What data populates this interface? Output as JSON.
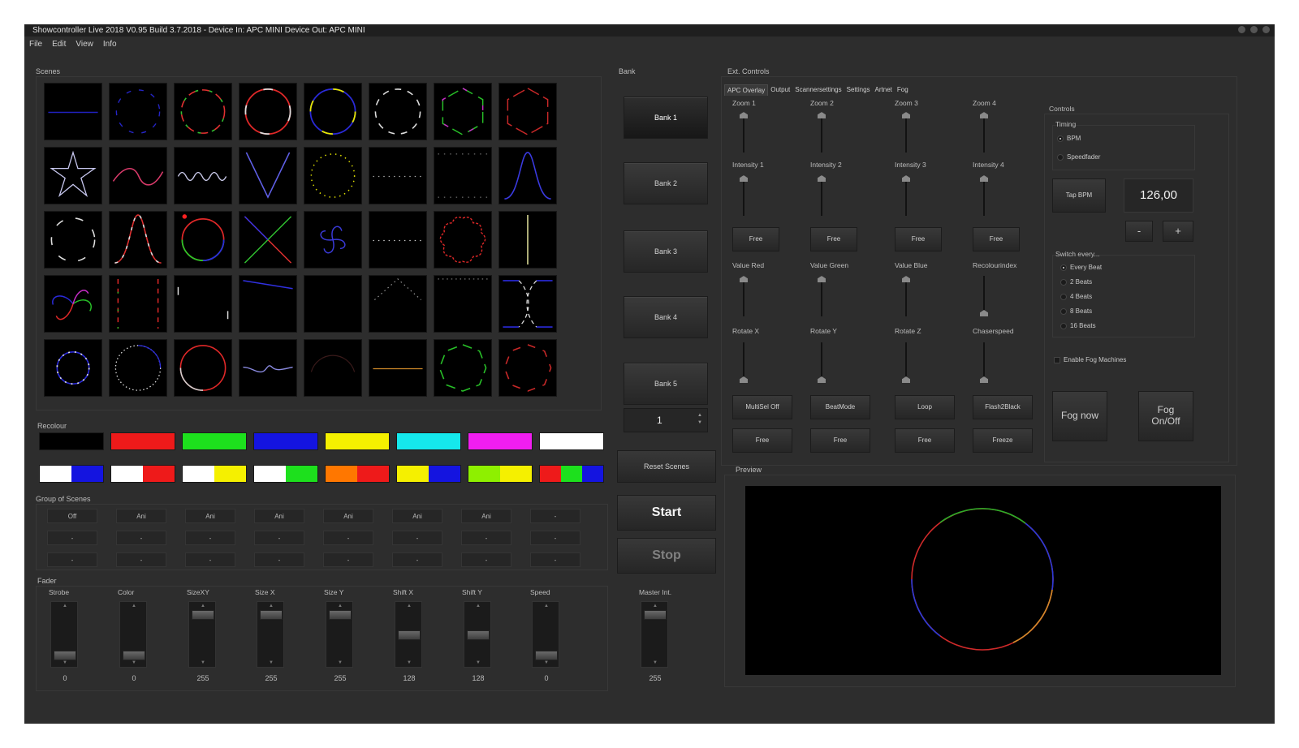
{
  "window": {
    "title": "Showcontroller Live 2018 V0.95 Build 3.7.2018 - Device In: APC MINI  Device Out: APC MINI"
  },
  "menu": [
    "File",
    "Edit",
    "View",
    "Info"
  ],
  "scenes": {
    "title": "Scenes"
  },
  "recolour": {
    "title": "Recolour",
    "row1": [
      [
        "#000000"
      ],
      [
        "#ee1a1a"
      ],
      [
        "#1de01d"
      ],
      [
        "#1414e0"
      ],
      [
        "#f5f000"
      ],
      [
        "#15e8ec"
      ],
      [
        "#f01ef0"
      ],
      [
        "#ffffff"
      ]
    ],
    "row2": [
      [
        "#ffffff",
        "#1414e0"
      ],
      [
        "#ffffff",
        "#ee1a1a"
      ],
      [
        "#ffffff",
        "#f5f000"
      ],
      [
        "#ffffff",
        "#1de01d"
      ],
      [
        "#ff7700",
        "#ee1a1a"
      ],
      [
        "#f5f000",
        "#1414e0"
      ],
      [
        "#8ef000",
        "#f5f000"
      ],
      [
        "#ee1a1a",
        "#1de01d",
        "#1414e0"
      ]
    ]
  },
  "group_of_scenes": {
    "title": "Group of Scenes",
    "rows": [
      [
        "Off",
        "Ani",
        "Ani",
        "Ani",
        "Ani",
        "Ani",
        "Ani",
        "-"
      ],
      [
        "-",
        "-",
        "-",
        "-",
        "-",
        "-",
        "-",
        "-"
      ],
      [
        "-",
        "-",
        "-",
        "-",
        "-",
        "-",
        "-",
        "-"
      ]
    ]
  },
  "fader": {
    "title": "Fader",
    "items": [
      {
        "label": "Strobe",
        "value": "0",
        "level": 0.0
      },
      {
        "label": "Color",
        "value": "0",
        "level": 0.0
      },
      {
        "label": "SizeXY",
        "value": "255",
        "level": 1.0
      },
      {
        "label": "Size X",
        "value": "255",
        "level": 1.0
      },
      {
        "label": "Size Y",
        "value": "255",
        "level": 1.0
      },
      {
        "label": "Shift X",
        "value": "128",
        "level": 0.5
      },
      {
        "label": "Shift Y",
        "value": "128",
        "level": 0.5
      },
      {
        "label": "Speed",
        "value": "0",
        "level": 0.0
      }
    ],
    "master": {
      "label": "Master Int.",
      "value": "255",
      "level": 1.0
    }
  },
  "bank": {
    "title": "Bank",
    "buttons": [
      "Bank 1",
      "Bank 2",
      "Bank 3",
      "Bank 4",
      "Bank 5"
    ],
    "spin_value": "1",
    "reset": "Reset Scenes",
    "start": "Start",
    "stop": "Stop"
  },
  "ext": {
    "title": "Ext. Controls",
    "tabs": [
      "APC Overlay",
      "Output",
      "Scannersettings",
      "Settings",
      "Artnet",
      "Fog"
    ],
    "zoom_labels": [
      "Zoom 1",
      "Zoom 2",
      "Zoom 3",
      "Zoom 4"
    ],
    "intensity_labels": [
      "Intensity 1",
      "Intensity 2",
      "Intensity 3",
      "Intensity 4"
    ],
    "free_row1": [
      "Free",
      "Free",
      "Free",
      "Free"
    ],
    "value_labels": [
      "Value Red",
      "Value Green",
      "Value Blue",
      "Recolourindex"
    ],
    "rotate_labels": [
      "Rotate X",
      "Rotate Y",
      "Rotate Z",
      "Chaserspeed"
    ],
    "mode_row": [
      "MultiSel Off",
      "BeatMode",
      "Loop",
      "Flash2Black"
    ],
    "free_row2": [
      "Free",
      "Free",
      "Free",
      "Freeze"
    ]
  },
  "controls": {
    "title": "Controls",
    "timing_title": "Timing",
    "timing_options": [
      "BPM",
      "Speedfader"
    ],
    "tap": "Tap BPM",
    "bpm": "126,00",
    "minus": "-",
    "plus": "+",
    "switch_title": "Switch every...",
    "switch_options": [
      "Every Beat",
      "2 Beats",
      "4 Beats",
      "8 Beats",
      "16 Beats"
    ],
    "enable_fog": "Enable Fog Machines",
    "fog_now": "Fog now",
    "fog_onoff": "Fog On/Off"
  },
  "preview": {
    "title": "Preview"
  }
}
